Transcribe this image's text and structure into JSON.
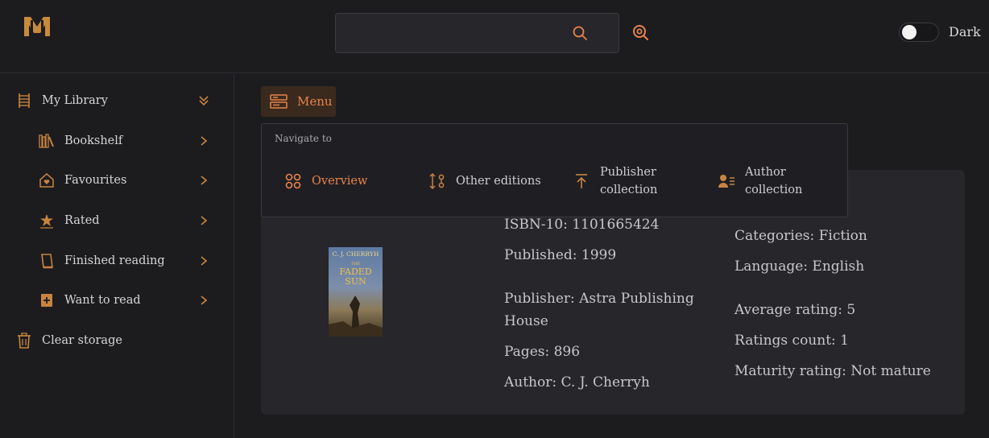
{
  "header": {
    "logo": "library-logo",
    "search": {
      "placeholder": "",
      "value": ""
    },
    "theme_toggle": {
      "label": "Dark",
      "on": false
    }
  },
  "colors": {
    "accent": "#e8834a",
    "background": "#1c1c1f",
    "card": "#26262b"
  },
  "sidebar": {
    "my_library": "My Library",
    "items": [
      {
        "label": "Bookshelf",
        "icon": "bookshelf-icon"
      },
      {
        "label": "Favourites",
        "icon": "favourites-icon"
      },
      {
        "label": "Rated",
        "icon": "rated-icon"
      },
      {
        "label": "Finished reading",
        "icon": "finished-reading-icon"
      },
      {
        "label": "Want to read",
        "icon": "want-to-read-icon"
      }
    ],
    "clear_storage": "Clear storage"
  },
  "menu_button": {
    "label": "Menu"
  },
  "nav_popup": {
    "title": "Navigate to",
    "items": [
      {
        "label": "Overview",
        "icon": "overview-icon",
        "active": true
      },
      {
        "label": "Other editions",
        "icon": "other-editions-icon"
      },
      {
        "label_line1": "Publisher",
        "label_line2": "collection",
        "icon": "publisher-collection-icon"
      },
      {
        "label_line1": "Author",
        "label_line2": "collection",
        "icon": "author-collection-icon"
      }
    ]
  },
  "book": {
    "cover_lines": [
      "C. J. CHERRYH",
      "THE",
      "FADED",
      "SUN"
    ],
    "isbn10": "ISBN-10: 1101665424",
    "published": "Published: 1999",
    "publisher_line1": "Publisher: Astra Publishing",
    "publisher_line2": "House",
    "pages": "Pages: 896",
    "author": "Author: C. J. Cherryh",
    "categories": "Categories: Fiction",
    "language": "Language: English",
    "average_rating": "Average rating: 5",
    "ratings_count": "Ratings count: 1",
    "maturity": "Maturity rating: Not mature"
  }
}
